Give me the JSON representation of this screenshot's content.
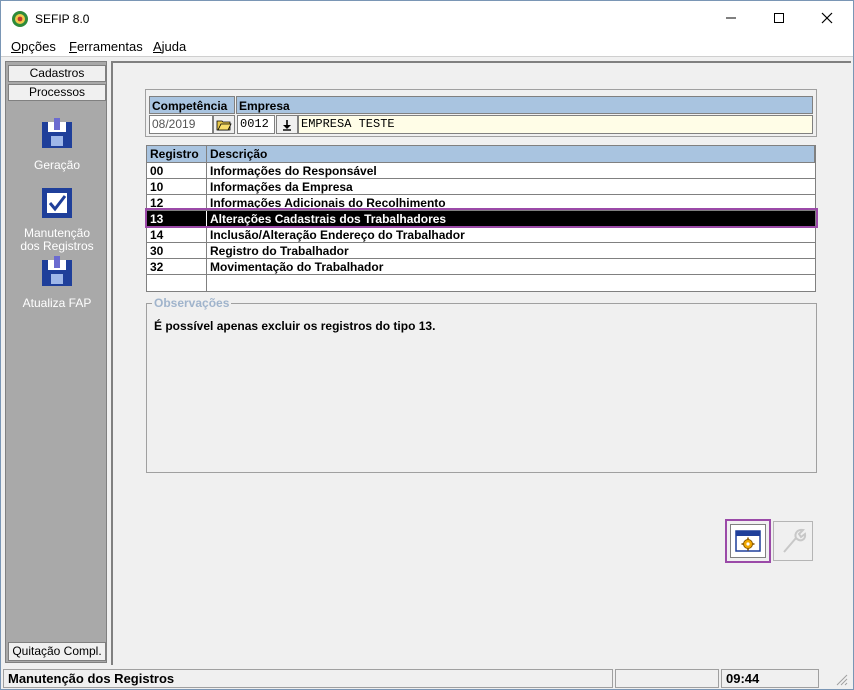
{
  "window": {
    "title": "SEFIP 8.0",
    "icon": "sefip-app-icon"
  },
  "menu": [
    {
      "label": "Opções",
      "accel": "O",
      "rest": "pções"
    },
    {
      "label": "Ferramentas",
      "accel": "F",
      "rest": "erramentas"
    },
    {
      "label": "Ajuda",
      "accel": "A",
      "rest": "juda"
    }
  ],
  "left_panel": {
    "tab_top": "Cadastros",
    "tab_active": "Processos",
    "tools": [
      {
        "label1": "Geração",
        "label2": "",
        "icon": "generation-icon"
      },
      {
        "label1": "Manutenção",
        "label2": "dos Registros",
        "icon": "maintenance-icon"
      },
      {
        "label1": "Atualiza FAP",
        "label2": "",
        "icon": "update-fap-icon"
      }
    ],
    "tab_bottom": "Quitação Compl."
  },
  "header_form": {
    "competencia_label": "Competência",
    "competencia_value": "08/2019",
    "empresa_label": "Empresa",
    "empresa_code": "0012",
    "empresa_name": "EMPRESA TESTE"
  },
  "registry_table": {
    "col_registro": "Registro",
    "col_descricao": "Descrição",
    "rows": [
      {
        "code": "00",
        "desc": "Informações do Responsável"
      },
      {
        "code": "10",
        "desc": "Informações da Empresa"
      },
      {
        "code": "12",
        "desc": "Informações Adicionais do Recolhimento"
      },
      {
        "code": "13",
        "desc": "Alterações Cadastrais dos Trabalhadores"
      },
      {
        "code": "14",
        "desc": "Inclusão/Alteração Endereço do Trabalhador"
      },
      {
        "code": "30",
        "desc": "Registro do Trabalhador"
      },
      {
        "code": "32",
        "desc": "Movimentação do Trabalhador"
      },
      {
        "code": "",
        "desc": ""
      }
    ],
    "selected_index": 3
  },
  "observacoes": {
    "legend": "Observações",
    "text": "É possível  apenas excluir os registros do tipo 13."
  },
  "status_bar": {
    "message": "Manutenção dos Registros",
    "panel2": "",
    "time": "09:44"
  },
  "colors": {
    "header_blue": "#a9c4e0",
    "highlight_purple": "#9b4aa8",
    "panel_gray": "#a9a9a9",
    "field_yellow": "#fffde7"
  }
}
